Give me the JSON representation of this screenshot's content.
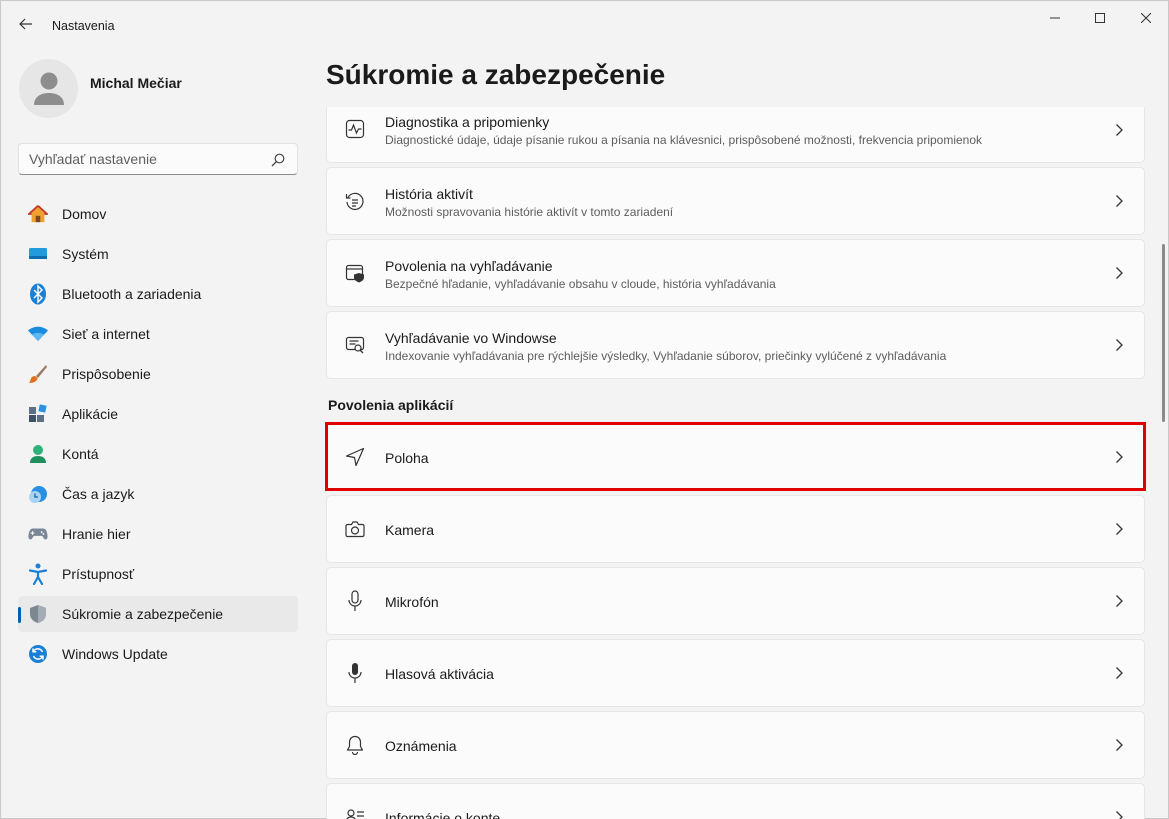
{
  "window": {
    "title": "Nastavenia"
  },
  "profile": {
    "name": "Michal Mečiar"
  },
  "search": {
    "placeholder": "Vyhľadať nastavenie"
  },
  "sidebar": {
    "items": [
      {
        "label": "Domov",
        "icon": "home-icon"
      },
      {
        "label": "Systém",
        "icon": "system-icon"
      },
      {
        "label": "Bluetooth a zariadenia",
        "icon": "bluetooth-icon"
      },
      {
        "label": "Sieť a internet",
        "icon": "wifi-icon"
      },
      {
        "label": "Prispôsobenie",
        "icon": "brush-icon"
      },
      {
        "label": "Aplikácie",
        "icon": "apps-icon"
      },
      {
        "label": "Kontá",
        "icon": "account-icon"
      },
      {
        "label": "Čas a jazyk",
        "icon": "clock-globe-icon"
      },
      {
        "label": "Hranie hier",
        "icon": "gamepad-icon"
      },
      {
        "label": "Prístupnosť",
        "icon": "accessibility-icon"
      },
      {
        "label": "Súkromie a zabezpečenie",
        "icon": "shield-icon",
        "selected": true
      },
      {
        "label": "Windows Update",
        "icon": "update-icon"
      }
    ]
  },
  "main": {
    "title": "Súkromie a zabezpečenie",
    "rows": [
      {
        "title": "Diagnostika a pripomienky",
        "subtitle": "Diagnostické údaje, údaje písanie rukou a písania na klávesnici, prispôsobené možnosti, frekvencia pripomienok",
        "icon": "diagnostics-icon"
      },
      {
        "title": "História aktivít",
        "subtitle": "Možnosti spravovania histórie aktivít v tomto zariadení",
        "icon": "history-icon"
      },
      {
        "title": "Povolenia na vyhľadávanie",
        "subtitle": "Bezpečné hľadanie, vyhľadávanie obsahu v cloude, história vyhľadávania",
        "icon": "search-permissions-icon"
      },
      {
        "title": "Vyhľadávanie vo Windowse",
        "subtitle": "Indexovanie vyhľadávania pre rýchlejšie výsledky, Vyhľadanie súborov, priečinky vylúčené z vyhľadávania",
        "icon": "windows-search-icon"
      }
    ],
    "section_header": "Povolenia aplikácií",
    "app_rows": [
      {
        "title": "Poloha",
        "icon": "location-icon",
        "highlighted": true
      },
      {
        "title": "Kamera",
        "icon": "camera-icon"
      },
      {
        "title": "Mikrofón",
        "icon": "microphone-icon"
      },
      {
        "title": "Hlasová aktivácia",
        "icon": "voice-activation-icon"
      },
      {
        "title": "Oznámenia",
        "icon": "bell-icon"
      },
      {
        "title": "Informácie o konte",
        "icon": "account-info-icon"
      }
    ]
  },
  "colors": {
    "accent": "#005fb8",
    "highlight_border": "#e00000"
  }
}
